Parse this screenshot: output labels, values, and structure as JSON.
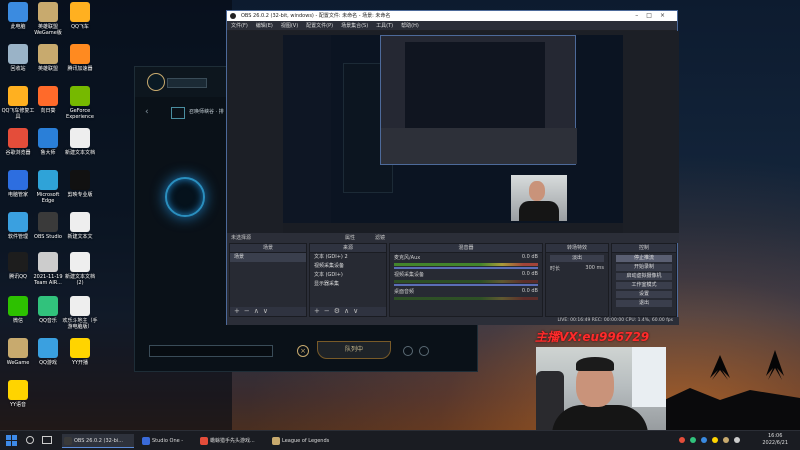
{
  "desktop": {
    "icons": [
      {
        "label": "此电脑",
        "color": "#3b8be0"
      },
      {
        "label": "英雄联盟 WeGame版",
        "color": "#c8aa6e"
      },
      {
        "label": "QQ飞车",
        "color": "#ffb020"
      },
      {
        "label": "回收站",
        "color": "#9ab3c7"
      },
      {
        "label": "英雄联盟",
        "color": "#c8aa6e"
      },
      {
        "label": "腾讯加速器",
        "color": "#ff8a20"
      },
      {
        "label": "QQ飞车修复工具",
        "color": "#ffb020"
      },
      {
        "label": "向日葵",
        "color": "#ff6a2a"
      },
      {
        "label": "GeForce Experience",
        "color": "#76b900"
      },
      {
        "label": "谷歌浏览器",
        "color": "#e44d3a"
      },
      {
        "label": "鲁大师",
        "color": "#2a7fd8"
      },
      {
        "label": "新建文本文档",
        "color": "#eeeeee"
      },
      {
        "label": "电脑管家",
        "color": "#2d6ee0"
      },
      {
        "label": "Microsoft Edge",
        "color": "#2fa3d8"
      },
      {
        "label": "剪映专业版",
        "color": "#111111"
      },
      {
        "label": "软件管理",
        "color": "#3aa0e0"
      },
      {
        "label": "OBS Studio",
        "color": "#3a3a3a"
      },
      {
        "label": "新建文本文",
        "color": "#eeeeee"
      },
      {
        "label": "腾讯QQ",
        "color": "#1d1d1d"
      },
      {
        "label": "2021-11-19 Team AIR...",
        "color": "#cccccc"
      },
      {
        "label": "新建文本文档 (2)",
        "color": "#eeeeee"
      },
      {
        "label": "微信",
        "color": "#2dc100"
      },
      {
        "label": "QQ音乐",
        "color": "#31c27c"
      },
      {
        "label": "欢乐斗地主（手游电脑版）",
        "color": "#eeeeee"
      },
      {
        "label": "WeGame",
        "color": "#c8aa6e"
      },
      {
        "label": "QQ游戏",
        "color": "#3aa0e0"
      },
      {
        "label": "YY开播",
        "color": "#ffd400"
      },
      {
        "label": "YY语音",
        "color": "#ffd400"
      }
    ]
  },
  "lol_client": {
    "mode_text": "召唤师峡谷 · 排",
    "queue_button": "队列中"
  },
  "obs": {
    "title": "OBS 26.0.2 (32-bit, windows) - 配置文件: 未命名 - 场景: 未命名",
    "menu": [
      "文件(F)",
      "编辑(E)",
      "视图(V)",
      "配置文件(P)",
      "场景集合(S)",
      "工具(T)",
      "帮助(H)"
    ],
    "undocked_labels": [
      "未选择源",
      "属性",
      "滤镜"
    ],
    "docks": {
      "scenes": {
        "title": "场景",
        "items": [
          "场景"
        ]
      },
      "sources": {
        "title": "来源",
        "items": [
          "文本 (GDI+) 2",
          "视频采集设备",
          "文本 (GDI+)",
          "显示器采集"
        ]
      },
      "mixer": {
        "title": "混音器",
        "channels": [
          {
            "name": "麦克风/Aux",
            "db": "0.0 dB"
          },
          {
            "name": "视频采集设备",
            "db": "0.0 dB"
          },
          {
            "name": "桌面音频",
            "db": "0.0 dB"
          }
        ]
      },
      "transitions": {
        "title": "转场特效",
        "type": "淡出",
        "duration_label": "时长",
        "duration": "300 ms"
      },
      "controls": {
        "title": "控制",
        "buttons": [
          "停止推流",
          "开始录制",
          "启动虚拟摄像机",
          "工作室模式",
          "设置",
          "退出"
        ]
      }
    },
    "status_bar": "LIVE: 00:16:49   REC: 00:00:00   CPU: 1.4%, 60.00 fps"
  },
  "overlay": {
    "watermark": "主播VX:eu996729"
  },
  "taskbar": {
    "items": [
      {
        "label": "OBS 26.0.2 (32-bi...",
        "color": "#3a3a3a"
      },
      {
        "label": "Studio One - 202...",
        "color": "#3a6ad8"
      },
      {
        "label": "蟾蜍猎手先头游戏...",
        "color": "#e44d3a"
      },
      {
        "label": "League of Legends",
        "color": "#c8aa6e"
      }
    ],
    "time": "16:06",
    "date": "2022/6/21"
  }
}
